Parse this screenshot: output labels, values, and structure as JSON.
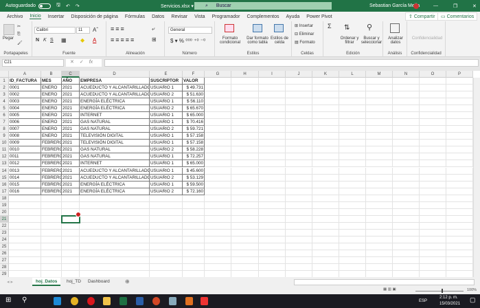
{
  "titlebar": {
    "autosave": "Autoguardado",
    "filename": "Servicios.xlsx ▾",
    "search": "Buscar",
    "user": "Sebastian García Mejía",
    "controls": [
      "—",
      "❐",
      "✕"
    ]
  },
  "menu": {
    "tabs": [
      "Archivo",
      "Inicio",
      "Insertar",
      "Disposición de página",
      "Fórmulas",
      "Datos",
      "Revisar",
      "Vista",
      "Programador",
      "Complementos",
      "Ayuda",
      "Power Pivot"
    ],
    "active": "Inicio",
    "share": "Compartir",
    "comments": "Comentarios"
  },
  "ribbon": {
    "groups": [
      "Portapapeles",
      "Fuente",
      "Alineación",
      "Número",
      "Estilos",
      "Celdas",
      "Edición",
      "Análisis",
      "Confidencialidad"
    ],
    "paste": "Pegar",
    "font": "Calibri",
    "size": "11",
    "bold": "N",
    "italic": "K",
    "underline": "S",
    "number_format": "General",
    "cond_format": "Formato condicional",
    "table_format": "Dar formato como tabla",
    "cell_styles": "Estilos de celda",
    "insert": "Insertar",
    "delete": "Eliminar",
    "format": "Formato",
    "sort": "Ordenar y filtrar",
    "find": "Buscar y seleccionar",
    "analyze": "Analizar datos",
    "confidentiality": "Confidencialidad"
  },
  "formula_bar": {
    "name_box": "C21",
    "fx": "fx",
    "value": ""
  },
  "columns": [
    "A",
    "B",
    "C",
    "D",
    "E",
    "F",
    "G",
    "H",
    "I",
    "J",
    "K",
    "L",
    "M",
    "N",
    "O",
    "P"
  ],
  "table": {
    "headers": [
      "ID_FACTURA",
      "MES",
      "AÑO",
      "EMPRESA",
      "SUSCRIPTOR",
      "VALOR"
    ],
    "rows": [
      [
        "0001",
        "ENERO",
        "2021",
        "ACUEDUCTO Y ALCANTARILLADO",
        "USUARIO 1",
        "$ 49.731"
      ],
      [
        "0002",
        "ENERO",
        "2021",
        "ACUEDUCTO Y ALCANTARILLADO",
        "USUARIO 2",
        "$ 51.630"
      ],
      [
        "0003",
        "ENERO",
        "2021",
        "ENERGÍA ELÉCTRICA",
        "USUARIO 1",
        "$ 56.110"
      ],
      [
        "0004",
        "ENERO",
        "2021",
        "ENERGÍA ELÉCTRICA",
        "USUARIO 2",
        "$ 65.670"
      ],
      [
        "0005",
        "ENERO",
        "2021",
        "INTERNET",
        "USUARIO 1",
        "$ 65.000"
      ],
      [
        "0006",
        "ENERO",
        "2021",
        "GAS NATURAL",
        "USUARIO 1",
        "$ 70.416"
      ],
      [
        "0007",
        "ENERO",
        "2021",
        "GAS NATURAL",
        "USUARIO 2",
        "$ 59.721"
      ],
      [
        "0008",
        "ENERO",
        "2021",
        "TELEVISIÓN DIGITAL",
        "USUARIO 1",
        "$ 57.158"
      ],
      [
        "0009",
        "FEBRERO",
        "2021",
        "TELEVISIÓN DIGITAL",
        "USUARIO 1",
        "$ 57.158"
      ],
      [
        "0010",
        "FEBRERO",
        "2021",
        "GAS NATURAL",
        "USUARIO 2",
        "$ 58.228"
      ],
      [
        "0011",
        "FEBRERO",
        "2021",
        "GAS NATURAL",
        "USUARIO 1",
        "$ 72.257"
      ],
      [
        "0012",
        "FEBRERO",
        "2021",
        "INTERNET",
        "USUARIO 1",
        "$ 65.000"
      ],
      [
        "0013",
        "FEBRERO",
        "2021",
        "ACUEDUCTO Y ALCANTARILLADO",
        "USUARIO 1",
        "$ 45.600"
      ],
      [
        "0014",
        "FEBRERO",
        "2021",
        "ACUEDUCTO Y ALCANTARILLADO",
        "USUARIO 2",
        "$ 53.129"
      ],
      [
        "0015",
        "FEBRERO",
        "2021",
        "ENERGÍA ELÉCTRICA",
        "USUARIO 1",
        "$ 59.500"
      ],
      [
        "0016",
        "FEBRERO",
        "2021",
        "ENERGÍA ELÉCTRICA",
        "USUARIO 2",
        "$ 72.160"
      ]
    ]
  },
  "selected_cell": "C21",
  "sheets": [
    "hoj_Datos",
    "hoj_TD",
    "Dashboard"
  ],
  "active_sheet": "hoj_Datos",
  "zoom": "100%",
  "taskbar": {
    "time": "2:12 p. m.",
    "date": "15/03/2021",
    "lang": "ESP"
  },
  "colors": {
    "accent": "#217346"
  }
}
